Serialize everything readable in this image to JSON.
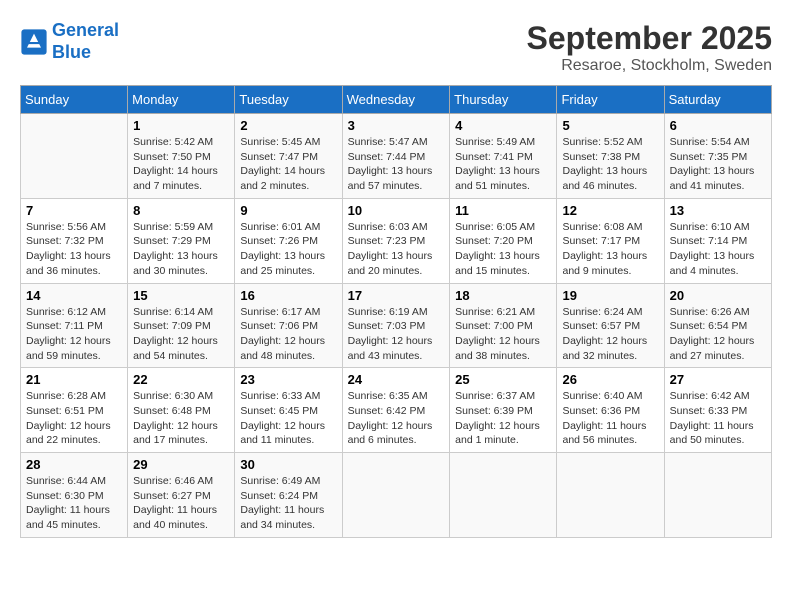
{
  "header": {
    "logo_line1": "General",
    "logo_line2": "Blue",
    "month": "September 2025",
    "location": "Resaroe, Stockholm, Sweden"
  },
  "days_of_week": [
    "Sunday",
    "Monday",
    "Tuesday",
    "Wednesday",
    "Thursday",
    "Friday",
    "Saturday"
  ],
  "weeks": [
    [
      {
        "day": "",
        "info": ""
      },
      {
        "day": "1",
        "info": "Sunrise: 5:42 AM\nSunset: 7:50 PM\nDaylight: 14 hours\nand 7 minutes."
      },
      {
        "day": "2",
        "info": "Sunrise: 5:45 AM\nSunset: 7:47 PM\nDaylight: 14 hours\nand 2 minutes."
      },
      {
        "day": "3",
        "info": "Sunrise: 5:47 AM\nSunset: 7:44 PM\nDaylight: 13 hours\nand 57 minutes."
      },
      {
        "day": "4",
        "info": "Sunrise: 5:49 AM\nSunset: 7:41 PM\nDaylight: 13 hours\nand 51 minutes."
      },
      {
        "day": "5",
        "info": "Sunrise: 5:52 AM\nSunset: 7:38 PM\nDaylight: 13 hours\nand 46 minutes."
      },
      {
        "day": "6",
        "info": "Sunrise: 5:54 AM\nSunset: 7:35 PM\nDaylight: 13 hours\nand 41 minutes."
      }
    ],
    [
      {
        "day": "7",
        "info": "Sunrise: 5:56 AM\nSunset: 7:32 PM\nDaylight: 13 hours\nand 36 minutes."
      },
      {
        "day": "8",
        "info": "Sunrise: 5:59 AM\nSunset: 7:29 PM\nDaylight: 13 hours\nand 30 minutes."
      },
      {
        "day": "9",
        "info": "Sunrise: 6:01 AM\nSunset: 7:26 PM\nDaylight: 13 hours\nand 25 minutes."
      },
      {
        "day": "10",
        "info": "Sunrise: 6:03 AM\nSunset: 7:23 PM\nDaylight: 13 hours\nand 20 minutes."
      },
      {
        "day": "11",
        "info": "Sunrise: 6:05 AM\nSunset: 7:20 PM\nDaylight: 13 hours\nand 15 minutes."
      },
      {
        "day": "12",
        "info": "Sunrise: 6:08 AM\nSunset: 7:17 PM\nDaylight: 13 hours\nand 9 minutes."
      },
      {
        "day": "13",
        "info": "Sunrise: 6:10 AM\nSunset: 7:14 PM\nDaylight: 13 hours\nand 4 minutes."
      }
    ],
    [
      {
        "day": "14",
        "info": "Sunrise: 6:12 AM\nSunset: 7:11 PM\nDaylight: 12 hours\nand 59 minutes."
      },
      {
        "day": "15",
        "info": "Sunrise: 6:14 AM\nSunset: 7:09 PM\nDaylight: 12 hours\nand 54 minutes."
      },
      {
        "day": "16",
        "info": "Sunrise: 6:17 AM\nSunset: 7:06 PM\nDaylight: 12 hours\nand 48 minutes."
      },
      {
        "day": "17",
        "info": "Sunrise: 6:19 AM\nSunset: 7:03 PM\nDaylight: 12 hours\nand 43 minutes."
      },
      {
        "day": "18",
        "info": "Sunrise: 6:21 AM\nSunset: 7:00 PM\nDaylight: 12 hours\nand 38 minutes."
      },
      {
        "day": "19",
        "info": "Sunrise: 6:24 AM\nSunset: 6:57 PM\nDaylight: 12 hours\nand 32 minutes."
      },
      {
        "day": "20",
        "info": "Sunrise: 6:26 AM\nSunset: 6:54 PM\nDaylight: 12 hours\nand 27 minutes."
      }
    ],
    [
      {
        "day": "21",
        "info": "Sunrise: 6:28 AM\nSunset: 6:51 PM\nDaylight: 12 hours\nand 22 minutes."
      },
      {
        "day": "22",
        "info": "Sunrise: 6:30 AM\nSunset: 6:48 PM\nDaylight: 12 hours\nand 17 minutes."
      },
      {
        "day": "23",
        "info": "Sunrise: 6:33 AM\nSunset: 6:45 PM\nDaylight: 12 hours\nand 11 minutes."
      },
      {
        "day": "24",
        "info": "Sunrise: 6:35 AM\nSunset: 6:42 PM\nDaylight: 12 hours\nand 6 minutes."
      },
      {
        "day": "25",
        "info": "Sunrise: 6:37 AM\nSunset: 6:39 PM\nDaylight: 12 hours\nand 1 minute."
      },
      {
        "day": "26",
        "info": "Sunrise: 6:40 AM\nSunset: 6:36 PM\nDaylight: 11 hours\nand 56 minutes."
      },
      {
        "day": "27",
        "info": "Sunrise: 6:42 AM\nSunset: 6:33 PM\nDaylight: 11 hours\nand 50 minutes."
      }
    ],
    [
      {
        "day": "28",
        "info": "Sunrise: 6:44 AM\nSunset: 6:30 PM\nDaylight: 11 hours\nand 45 minutes."
      },
      {
        "day": "29",
        "info": "Sunrise: 6:46 AM\nSunset: 6:27 PM\nDaylight: 11 hours\nand 40 minutes."
      },
      {
        "day": "30",
        "info": "Sunrise: 6:49 AM\nSunset: 6:24 PM\nDaylight: 11 hours\nand 34 minutes."
      },
      {
        "day": "",
        "info": ""
      },
      {
        "day": "",
        "info": ""
      },
      {
        "day": "",
        "info": ""
      },
      {
        "day": "",
        "info": ""
      }
    ]
  ]
}
